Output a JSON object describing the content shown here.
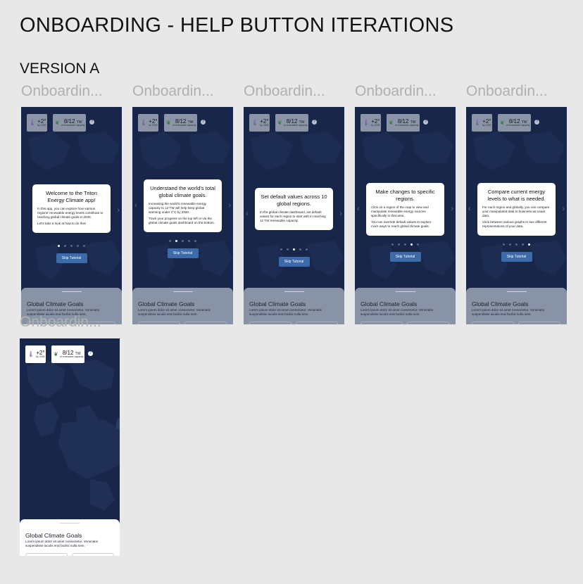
{
  "page_title": "ONBOARDING - HELP BUTTON ITERATIONS",
  "version_label": "VERSION A",
  "common": {
    "frame_label": "Onboardin...",
    "temp_value": "+2°",
    "temp_sub": "by 2030",
    "capacity_value": "8/12",
    "capacity_unit": "TW",
    "capacity_sub": "of renewable capacity",
    "help_glyph": "?",
    "skip_label": "Skip Tutorial",
    "sheet_title": "Global Climate Goals",
    "sheet_body": "Lorem ipsum dolor sit amet consectetur. Venenatis suspendisse iaculis erat facilisi nulla sem.",
    "icons": {
      "temperature": "thermometer-icon",
      "capacity": "plant-icon",
      "help": "question-icon",
      "prev": "chevron-left-icon",
      "next": "chevron-right-icon"
    }
  },
  "steps": [
    {
      "title": "Welcome to the Triton Energy Climate app!",
      "paragraphs": [
        "In this app, you can explore how various regions' renewable energy levels contribute to reaching global climate goals in 2030.",
        "Let's take a look at how to do this!"
      ],
      "active_dot": 1
    },
    {
      "title": "Understand the world's total global climate goals.",
      "paragraphs": [
        "Increasing the world's renewable energy capacity to 12 TW will help keep global warming under 2°C by 2030.",
        "Track your progress on the top left or via the global climate goals dashboard on the bottom."
      ],
      "active_dot": 2
    },
    {
      "title": "Set default values across 10 global regions.",
      "paragraphs": [
        "In the global climate dashboard, set default values for each region to start with in reaching 12 TW renewable capacity."
      ],
      "active_dot": 3
    },
    {
      "title": "Make changes to specific regions.",
      "paragraphs": [
        "Click on a region of the map to view and manipulate renewable energy sources specifically in that area.",
        "You can override default values to explore more ways to reach global climate goals."
      ],
      "active_dot": 4
    },
    {
      "title": "Compare current energy levels to what is needed.",
      "paragraphs": [
        "For each region and globally, you can compare your manipulated data to business-as-usual data.",
        "Click between various graphs to see different representations of your data."
      ],
      "active_dot": 5
    }
  ],
  "colors": {
    "background": "#e8e8e8",
    "screen": "#18264a",
    "button": "#3d6aa8",
    "card": "#ffffff"
  }
}
